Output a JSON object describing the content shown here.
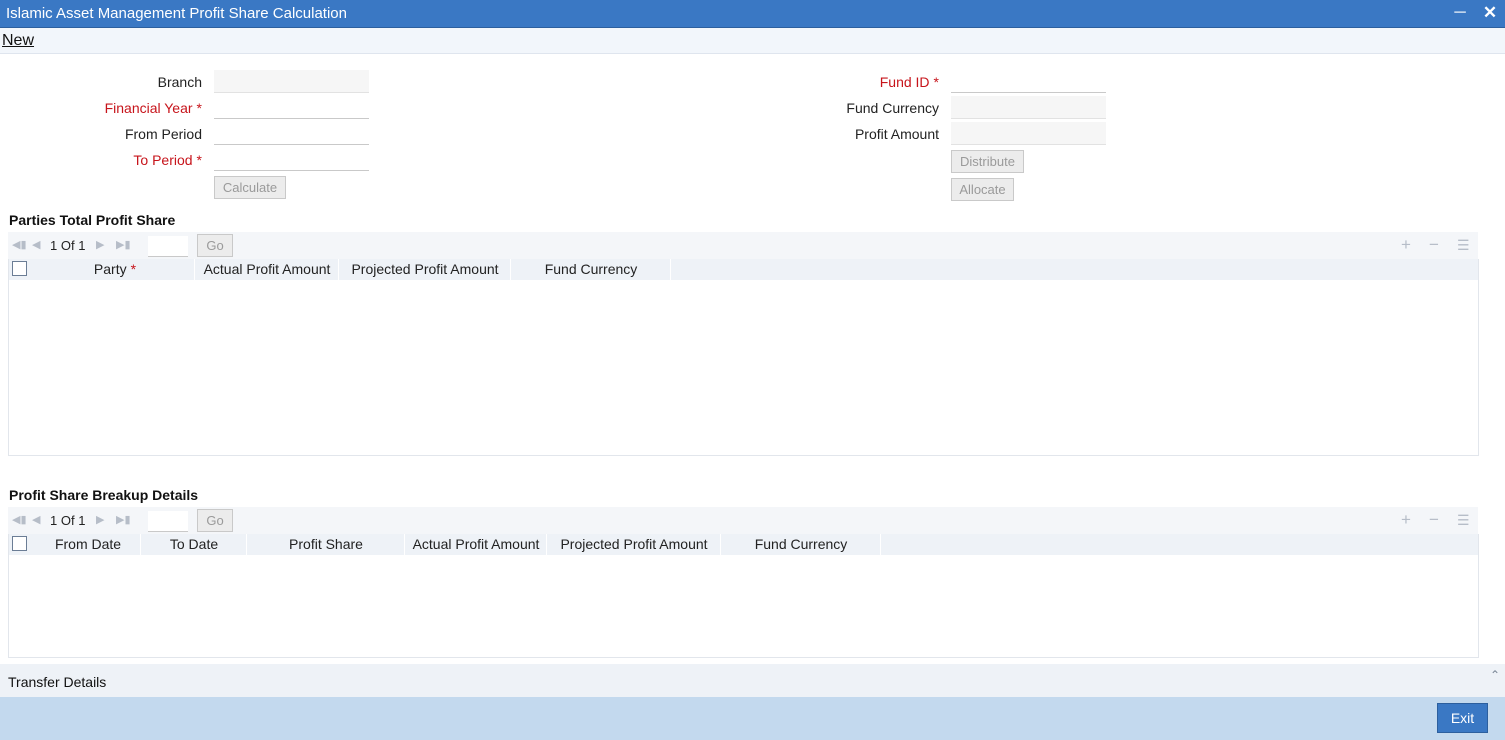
{
  "window": {
    "title": "Islamic Asset Management Profit Share Calculation",
    "minimize_icon": "minimize-icon",
    "close_icon": "close-icon",
    "accent_color": "#3a78c4"
  },
  "toolbar": {
    "new_label": "New"
  },
  "form": {
    "branch_label": "Branch",
    "branch_value": "",
    "financial_year_label": "Financial Year",
    "financial_year_value": "",
    "from_period_label": "From Period",
    "from_period_value": "",
    "to_period_label": "To Period",
    "to_period_value": "",
    "calculate_label": "Calculate",
    "fund_id_label": "Fund ID",
    "fund_id_value": "",
    "fund_currency_label": "Fund Currency",
    "fund_currency_value": "",
    "profit_amount_label": "Profit Amount",
    "profit_amount_value": "",
    "distribute_label": "Distribute",
    "allocate_label": "Allocate",
    "required_mark": "*",
    "required_color": "#c7141b"
  },
  "parties": {
    "title": "Parties Total Profit Share",
    "pager": {
      "current": "1",
      "of_label": "Of",
      "total": "1",
      "go_label": "Go"
    },
    "columns": [
      "Party",
      "Actual Profit Amount",
      "Projected Profit Amount",
      "Fund Currency"
    ],
    "rows": []
  },
  "breakup": {
    "title": "Profit Share Breakup Details",
    "pager": {
      "current": "1",
      "of_label": "Of",
      "total": "1",
      "go_label": "Go"
    },
    "columns": [
      "From Date",
      "To Date",
      "Profit Share",
      "Actual Profit Amount",
      "Projected Profit Amount",
      "Fund Currency"
    ],
    "rows": []
  },
  "transfer": {
    "label": "Transfer Details"
  },
  "footer": {
    "exit_label": "Exit"
  }
}
